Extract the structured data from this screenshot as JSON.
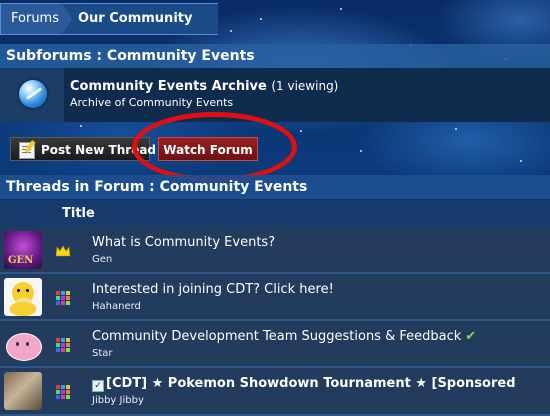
{
  "breadcrumb": {
    "items": [
      "Forums",
      "Our Community"
    ]
  },
  "subforum_header": "Subforums : Community Events",
  "forum": {
    "title": "Community Events Archive",
    "viewing": "(1 viewing)",
    "description": "Archive of Community Events"
  },
  "buttons": {
    "post_new_thread": "Post New Thread",
    "watch_forum": "Watch Forum"
  },
  "threads_header": "Threads in Forum : Community Events",
  "columns": {
    "title": "Title"
  },
  "threads": [
    {
      "title": "What is Community Events?",
      "author": "Gen",
      "status_icon": "crown-icon",
      "avatar": "avatar-gen"
    },
    {
      "title": "Interested in joining CDT? Click here!",
      "author": "Hahanerd",
      "status_icon": "grid-icon",
      "avatar": "avatar-psyduck"
    },
    {
      "title": "Community Development Team Suggestions & Feedback",
      "author": "Star",
      "status_icon": "grid-icon",
      "avatar": "avatar-pink",
      "badge": "✔"
    },
    {
      "title": "[CDT] ★ Pokemon Showdown Tournament ★ [Sponsored",
      "author": "Jibby Jibby",
      "status_icon": "grid-icon",
      "avatar": "avatar-photo"
    }
  ],
  "colors": {
    "header_blue": "#285fa0",
    "row_bg": "#233b5c",
    "watch_red": "#9a2020",
    "annotation_red": "#e01010"
  }
}
